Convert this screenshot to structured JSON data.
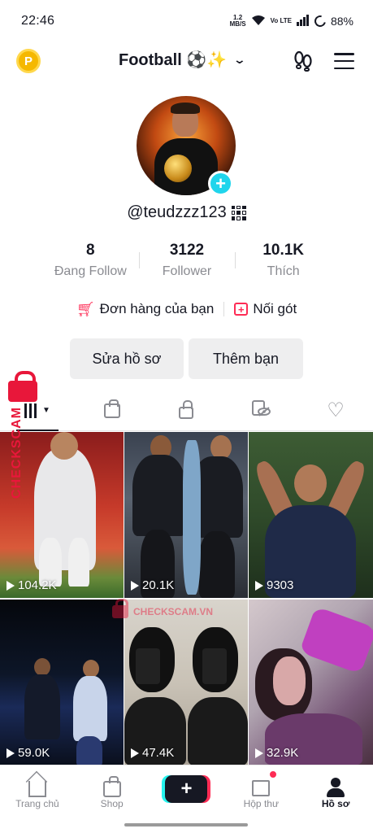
{
  "status_bar": {
    "time": "22:46",
    "net_speed": "1.2",
    "net_unit": "MB/S",
    "volte": "Vo LTE",
    "battery": "88%"
  },
  "header": {
    "account_name": "Football ⚽✨",
    "coin_label": "P"
  },
  "profile": {
    "username": "@teudzzz123"
  },
  "stats": [
    {
      "value": "8",
      "label": "Đang Follow"
    },
    {
      "value": "3122",
      "label": "Follower"
    },
    {
      "value": "10.1K",
      "label": "Thích"
    }
  ],
  "links": {
    "orders": "Đơn hàng của bạn",
    "gifts": "Nối gót"
  },
  "buttons": {
    "edit_profile": "Sửa hồ sơ",
    "add_friends": "Thêm bạn"
  },
  "tabs": [
    "videos",
    "shop",
    "private",
    "reposts",
    "liked"
  ],
  "videos": [
    {
      "views": "104.2K"
    },
    {
      "views": "20.1K"
    },
    {
      "views": "9303"
    },
    {
      "views": "59.0K"
    },
    {
      "views": "47.4K"
    },
    {
      "views": "32.9K"
    }
  ],
  "watermark": {
    "text": "CHECKSCAM",
    "text2": "CHECKSCAM.VN"
  },
  "bottom_nav": {
    "home": "Trang chủ",
    "shop": "Shop",
    "create": "+",
    "inbox": "Hộp thư",
    "profile": "Hồ sơ"
  },
  "colors": {
    "accent_red": "#fe2c55",
    "accent_cyan": "#20d5ec",
    "coin": "#f5b800"
  }
}
